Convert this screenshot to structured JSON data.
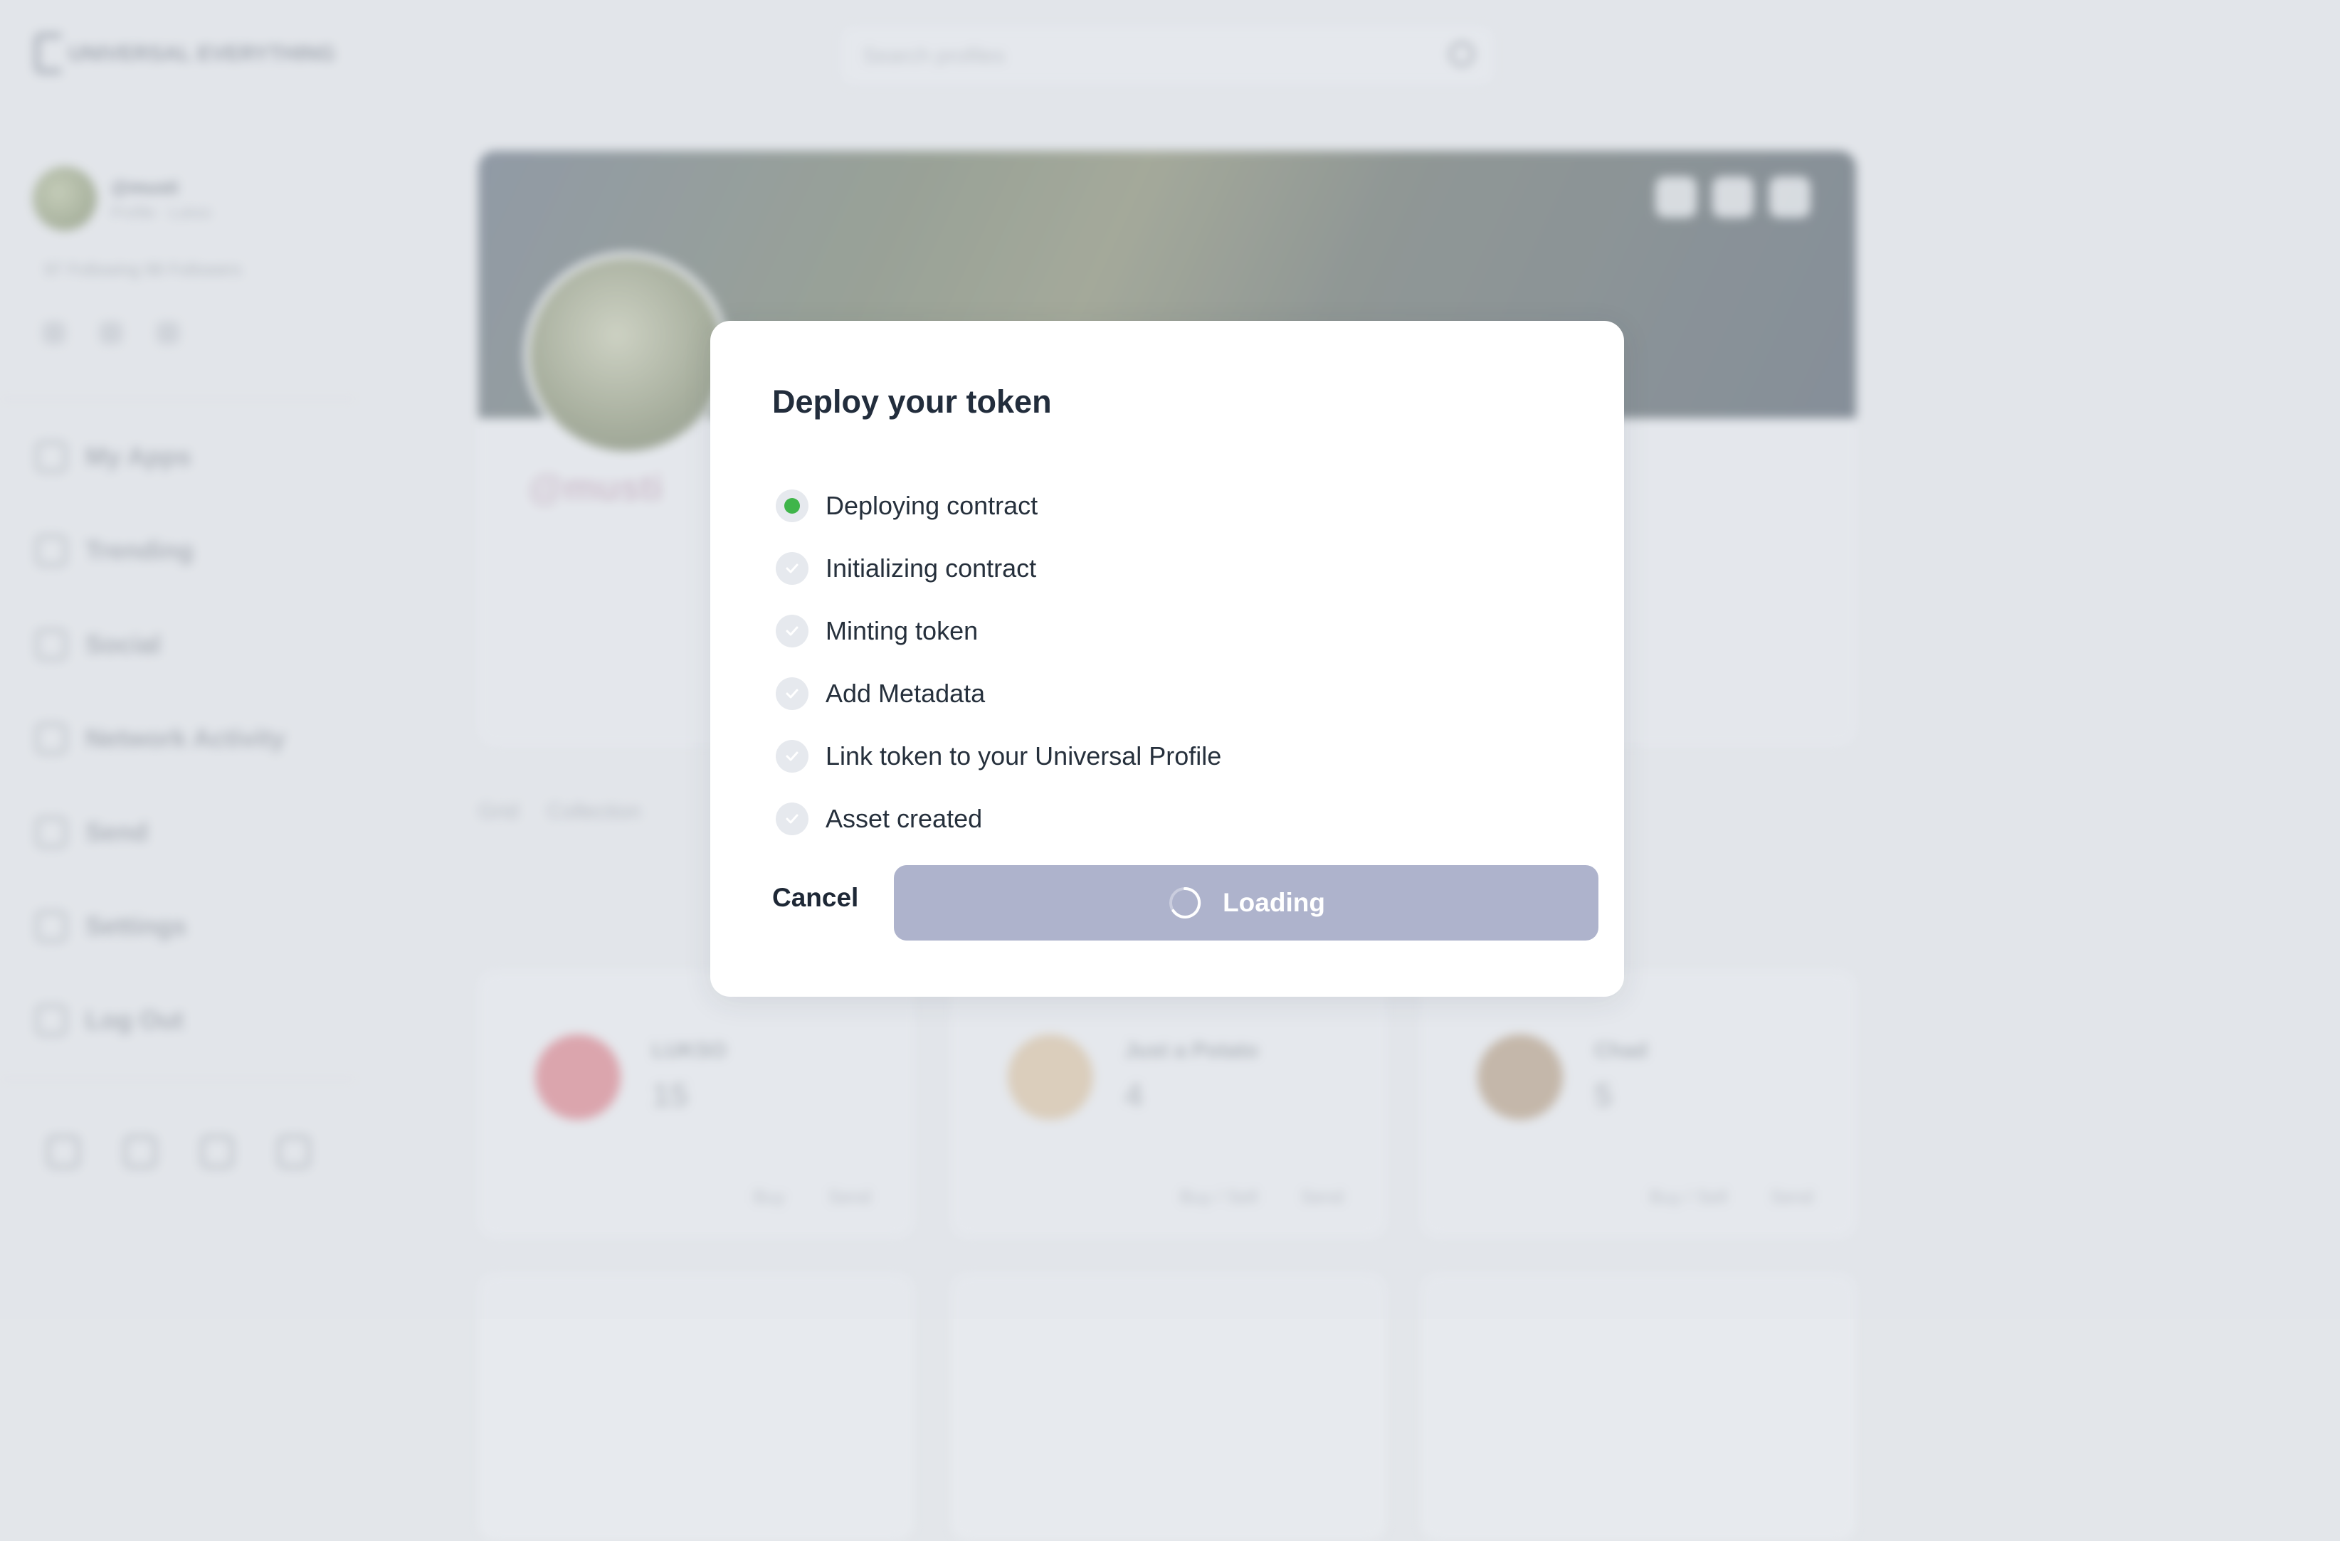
{
  "modal": {
    "title": "Deploy your token",
    "steps": [
      {
        "label": "Deploying contract",
        "state": "active"
      },
      {
        "label": "Initializing contract",
        "state": "pending"
      },
      {
        "label": "Minting token",
        "state": "pending"
      },
      {
        "label": "Add Metadata",
        "state": "pending"
      },
      {
        "label": "Link token to your Universal Profile",
        "state": "pending"
      },
      {
        "label": "Asset created",
        "state": "pending"
      }
    ],
    "cancel_label": "Cancel",
    "primary_label": "Loading"
  },
  "background": {
    "logo_text": "UNIVERSAL EVERYTHING",
    "search_placeholder": "Search profiles",
    "user_name": "@musti",
    "user_sub": "Profile · Lukso",
    "follow_text": "97 Following   98 Followers",
    "nav_items": [
      "My Apps",
      "Trending",
      "Social",
      "Network Activity",
      "Send",
      "Settings",
      "Log Out"
    ],
    "profile_handle": "@musti",
    "tabs": [
      "Grid",
      "Collection"
    ],
    "cards": [
      {
        "name": "LUKSO",
        "qty": "15",
        "actions": [
          "Buy",
          "Send"
        ]
      },
      {
        "name": "Just a Potato",
        "qty": "4",
        "actions": [
          "Buy / Sell",
          "Send"
        ]
      },
      {
        "name": "Chad",
        "qty": "5",
        "actions": [
          "Buy / Sell",
          "Send"
        ]
      }
    ]
  },
  "colors": {
    "active_step": "#3fb54a",
    "primary_button": "#aeb3cc",
    "step_icon_bg": "#e6e9ee"
  }
}
